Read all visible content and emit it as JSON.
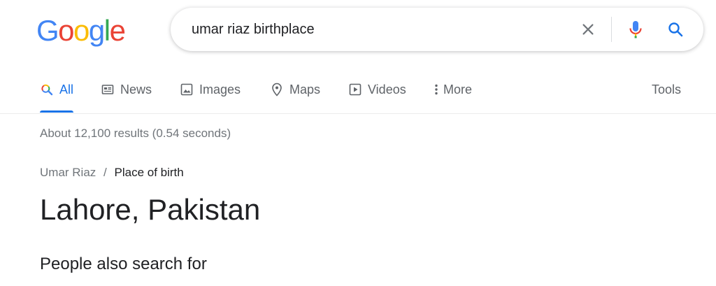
{
  "logo": {
    "text": "Google",
    "letters": [
      {
        "char": "G",
        "color": "#4285F4"
      },
      {
        "char": "o",
        "color": "#EA4335"
      },
      {
        "char": "o",
        "color": "#FBBC05"
      },
      {
        "char": "g",
        "color": "#4285F4"
      },
      {
        "char": "l",
        "color": "#34A853"
      },
      {
        "char": "e",
        "color": "#EA4335"
      }
    ]
  },
  "search": {
    "query": "umar riaz birthplace"
  },
  "tabs": {
    "all": "All",
    "news": "News",
    "images": "Images",
    "maps": "Maps",
    "videos": "Videos",
    "more": "More",
    "tools": "Tools"
  },
  "results": {
    "stats": "About 12,100 results (0.54 seconds)",
    "breadcrumb": {
      "entity": "Umar Riaz",
      "separator": "/",
      "attribute": "Place of birth"
    },
    "answer": "Lahore, Pakistan",
    "people_also_search": "People also search for"
  },
  "colors": {
    "accent": "#1a73e8",
    "muted": "#70757a",
    "text": "#202124"
  }
}
